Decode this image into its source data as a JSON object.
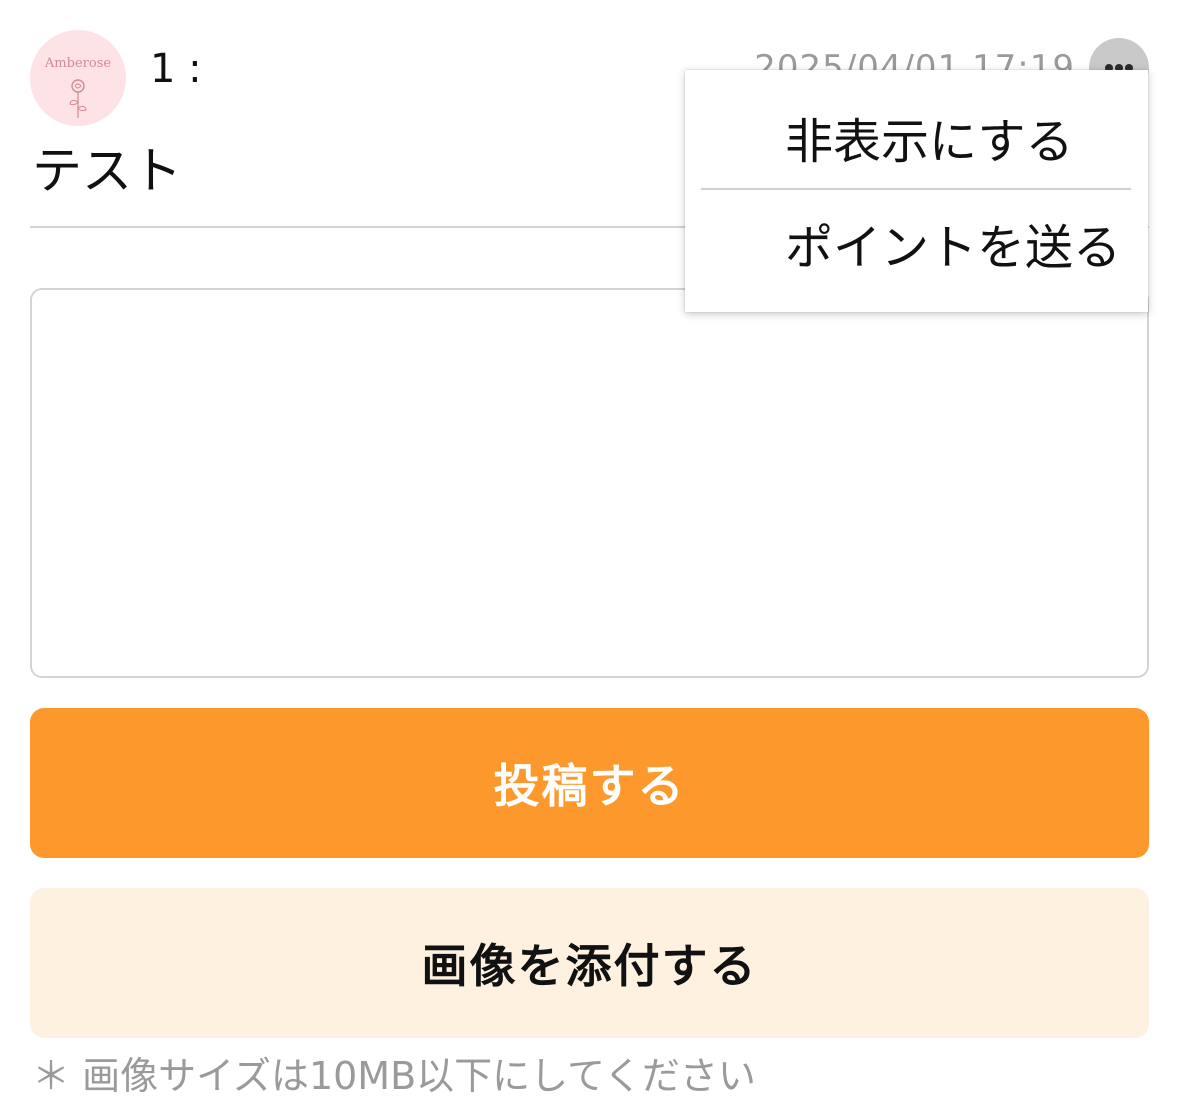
{
  "post": {
    "avatar_brand": "Amberose",
    "number": "1 :",
    "timestamp": "2025/04/01 17:19",
    "body": "テスト"
  },
  "menu": {
    "items": [
      {
        "label": "非表示にする"
      },
      {
        "label": "ポイントを送る"
      }
    ]
  },
  "reply": {
    "value": "",
    "placeholder": ""
  },
  "buttons": {
    "post_label": "投稿する",
    "attach_label": "画像を添付する"
  },
  "note": "＊ 画像サイズは10MB以下にしてください",
  "icons": {
    "more": "more-horizontal-icon",
    "avatar_rose": "rose-icon"
  },
  "colors": {
    "primary": "#fd982c",
    "secondary_bg": "#fef1e0",
    "muted_text": "#9a9a9a",
    "avatar_bg": "#fde3e6"
  }
}
